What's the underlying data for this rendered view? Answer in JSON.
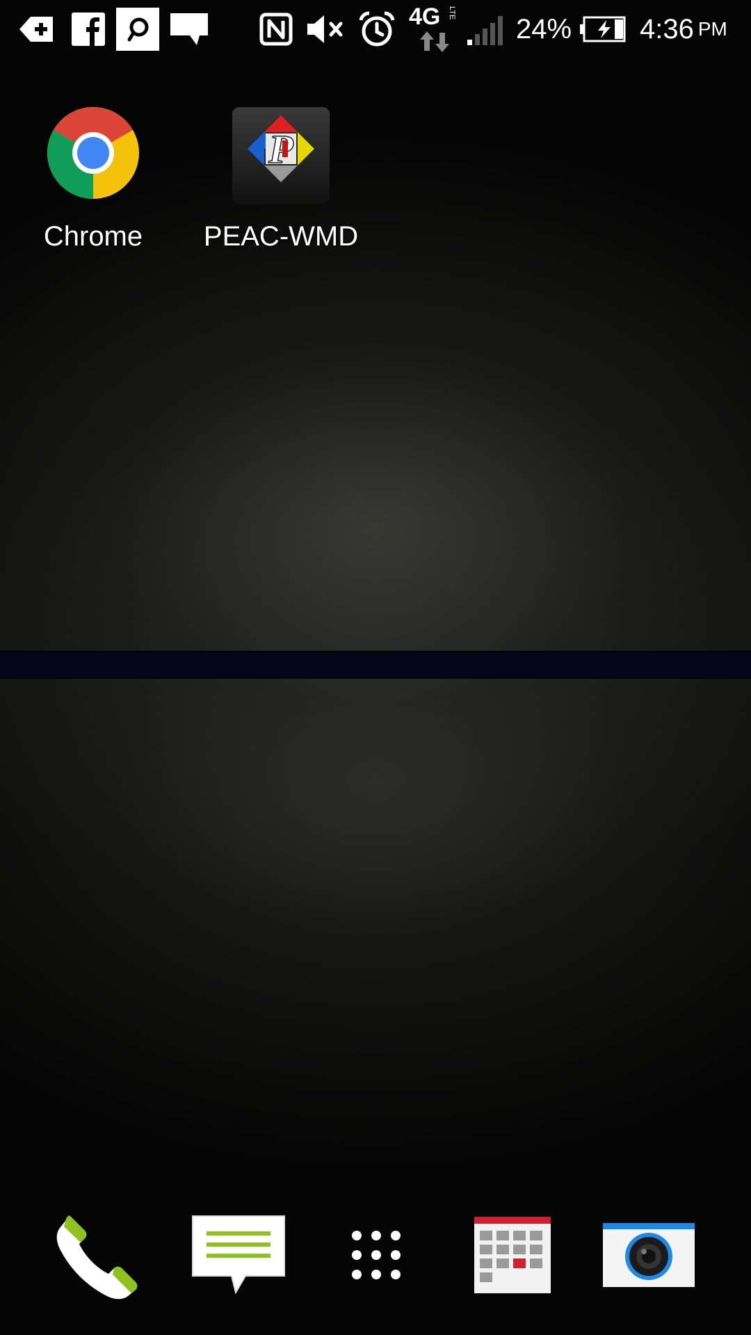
{
  "status_bar": {
    "notifications": [
      "add-icon",
      "facebook-icon",
      "peak-app-icon",
      "message-icon"
    ],
    "indicators": [
      "nfc-icon",
      "mute-icon",
      "alarm-icon",
      "network-4g-lte-icon",
      "signal-icon"
    ],
    "network_label": "4G",
    "network_sublabel": "LTE",
    "battery_percent": "24%",
    "battery_level": 0.24,
    "battery_charging": true,
    "time": "4:36",
    "ampm": "PM"
  },
  "home": {
    "apps": [
      {
        "label": "Chrome",
        "icon": "chrome-icon"
      },
      {
        "label": "PEAC-WMD",
        "icon": "peac-wmd-icon"
      }
    ]
  },
  "dock": {
    "items": [
      "phone-icon",
      "messages-icon",
      "app-drawer-icon",
      "calendar-icon",
      "camera-icon"
    ]
  },
  "colors": {
    "chrome_red": "#DB4437",
    "chrome_yellow": "#F4C20D",
    "chrome_green": "#0F9D58",
    "chrome_blue": "#4285F4",
    "dock_green": "#8DC21F",
    "calendar_red": "#D0202E",
    "camera_blue": "#1E88E5"
  }
}
